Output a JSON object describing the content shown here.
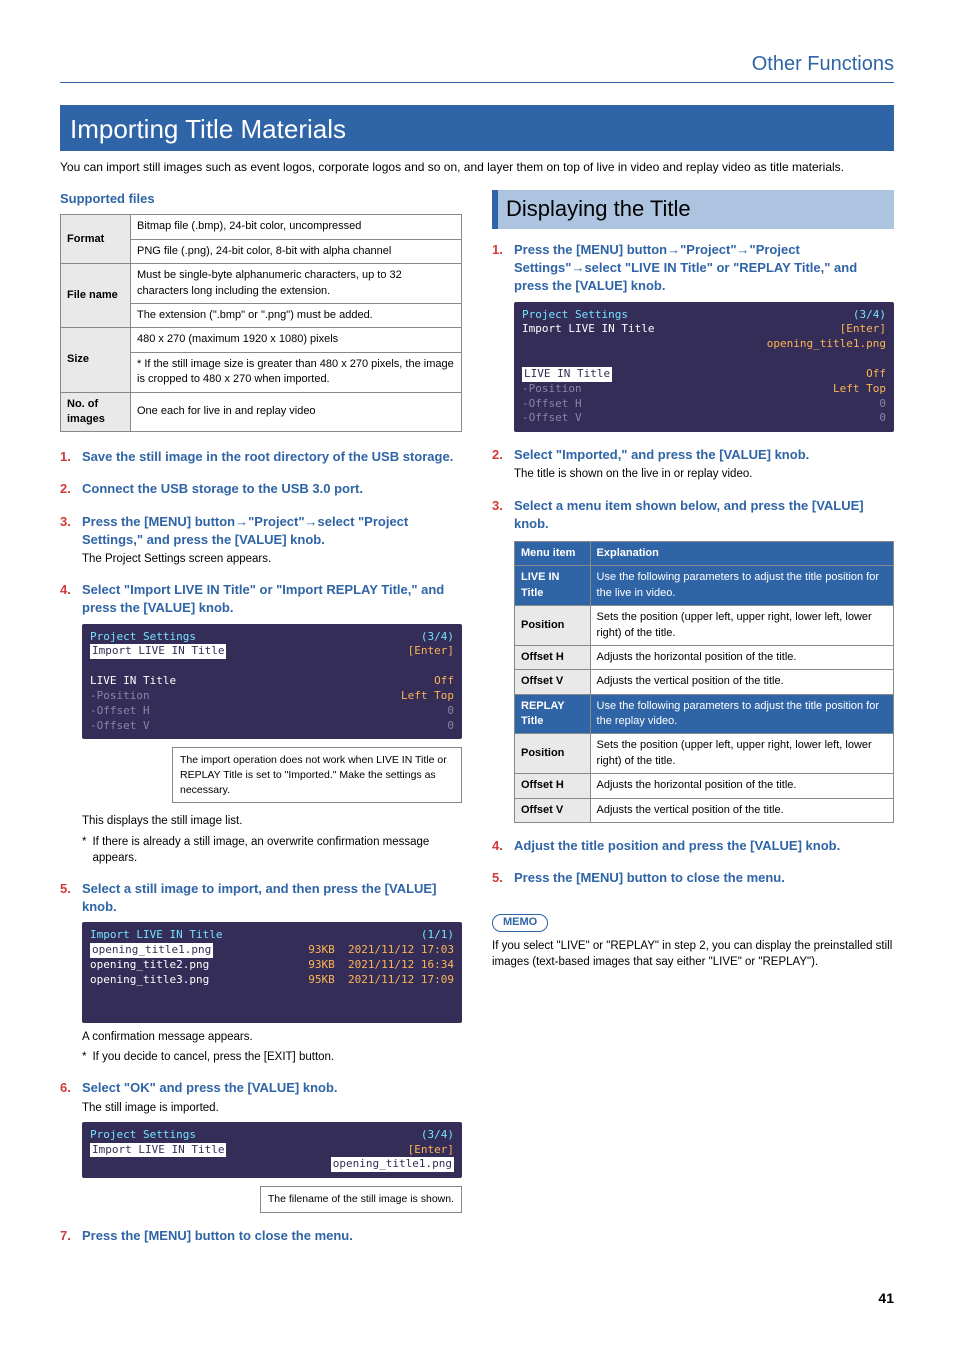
{
  "header": {
    "section": "Other Functions"
  },
  "title_banner": "Importing Title Materials",
  "intro": "You can import still images such as event logos, corporate logos and so on, and layer them on top of live in video and replay video as title materials.",
  "supported_files": {
    "heading": "Supported files",
    "rows": {
      "format_label": "Format",
      "format_v1": "Bitmap file (.bmp), 24-bit color, uncompressed",
      "format_v2": "PNG file (.png), 24-bit color, 8-bit with alpha channel",
      "filename_label": "File name",
      "filename_v1": "Must be single-byte alphanumeric characters, up to 32 characters long including the extension.",
      "filename_v2": "The extension (\".bmp\" or \".png\") must be added.",
      "size_label": "Size",
      "size_v1": "480 x 270  (maximum 1920 x 1080) pixels",
      "size_v2": "* If the still image size is greater than 480 x 270 pixels, the image is cropped to 480 x 270 when imported.",
      "num_label": "No. of images",
      "num_v1": "One each for live in and replay video"
    }
  },
  "steps_left": {
    "s1": "Save the still image in the root directory of the USB storage.",
    "s2": "Connect the USB storage to the USB 3.0 port.",
    "s3_a": "Press the [MENU] button",
    "s3_b": "\"Project\"",
    "s3_c": "select \"Project Settings,\" and press the [VALUE] knob.",
    "s3_body": "The Project Settings screen appears.",
    "s4": "Select \"Import LIVE IN Title\" or \"Import REPLAY Title,\" and press the [VALUE] knob.",
    "s4_callout": "The import operation does not work when LIVE IN Title or REPLAY Title is set to \"Imported.\" Make the settings as necessary.",
    "s4_foot1": "This displays the still image list.",
    "s4_foot2": "If there is already a still image, an overwrite confirmation message appears.",
    "s5": "Select a still image to import, and then press the [VALUE] knob.",
    "s5_foot1": "A confirmation message appears.",
    "s5_foot2": "If you decide to cancel, press the [EXIT] button.",
    "s6": "Select \"OK\" and press the [VALUE] knob.",
    "s6_body": "The still image is imported.",
    "s6_callout": "The filename of the still image is shown.",
    "s7": "Press the [MENU] button to close the menu."
  },
  "screens": {
    "a": {
      "l1a": "Project Settings",
      "l1b": "(3/4)",
      "l2a": "Import LIVE IN Title",
      "l2b": "[Enter]",
      "l4a": "LIVE IN Title",
      "l4b": "Off",
      "l5a": "-Position",
      "l5b": "Left Top",
      "l6a": "-Offset H",
      "l6b": "0",
      "l7a": "-Offset V",
      "l7b": "0"
    },
    "b": {
      "l1a": "Import LIVE IN Title",
      "l1b": "(1/1)",
      "rows": [
        {
          "name": "opening_title1.png",
          "size": "93KB",
          "date": "2021/11/12 17:03"
        },
        {
          "name": "opening_title2.png",
          "size": "93KB",
          "date": "2021/11/12 16:34"
        },
        {
          "name": "opening_title3.png",
          "size": "95KB",
          "date": "2021/11/12 17:09"
        }
      ]
    },
    "c": {
      "l1a": "Project Settings",
      "l1b": "(3/4)",
      "l2a": "Import LIVE IN Title",
      "l2b": "[Enter]",
      "l3b": "opening_title1.png"
    },
    "d": {
      "l1a": "Project Settings",
      "l1b": "(3/4)",
      "l2a": "Import LIVE IN Title",
      "l2b": "[Enter]",
      "l3b": "opening_title1.png",
      "l4a": "LIVE IN Title",
      "l4b": "Off",
      "l5a": "-Position",
      "l5b": "Left Top",
      "l6a": "-Offset H",
      "l6b": "0",
      "l7a": "-Offset V",
      "l7b": "0"
    }
  },
  "right": {
    "title": "Displaying the Title",
    "s1_a": "Press the [MENU] button",
    "s1_b": "\"Project\"",
    "s1_c": "\"Project Settings\"",
    "s1_d": "select \"LIVE IN Title\" or \"REPLAY Title,\" and press the [VALUE] knob.",
    "s2": "Select \"Imported,\" and press the [VALUE] knob.",
    "s2_body": "The title is shown on the live in or replay video.",
    "s3": "Select a menu item shown below, and press the [VALUE] knob.",
    "table": {
      "h1": "Menu item",
      "h2": "Explanation",
      "live_label": "LIVE IN Title",
      "live_desc": "Use the following parameters to adjust the title position for the live in video.",
      "pos": "Position",
      "pos_desc": "Sets the position (upper left, upper right, lower left, lower right) of the title.",
      "offh": "Offset H",
      "offh_desc": "Adjusts the horizontal position of the title.",
      "offv": "Offset V",
      "offv_desc": "Adjusts the vertical position of the title.",
      "replay_label": "REPLAY Title",
      "replay_desc": "Use the following parameters to adjust the title position for the replay video."
    },
    "s4": "Adjust the title position and press the [VALUE] knob.",
    "s5": "Press the [MENU] button to close the menu.",
    "memo_label": "MEMO",
    "memo_body": "If you select \"LIVE\" or \"REPLAY\" in step 2, you can display the preinstalled still images (text-based images that say either \"LIVE\" or \"REPLAY\")."
  },
  "page_number": "41"
}
